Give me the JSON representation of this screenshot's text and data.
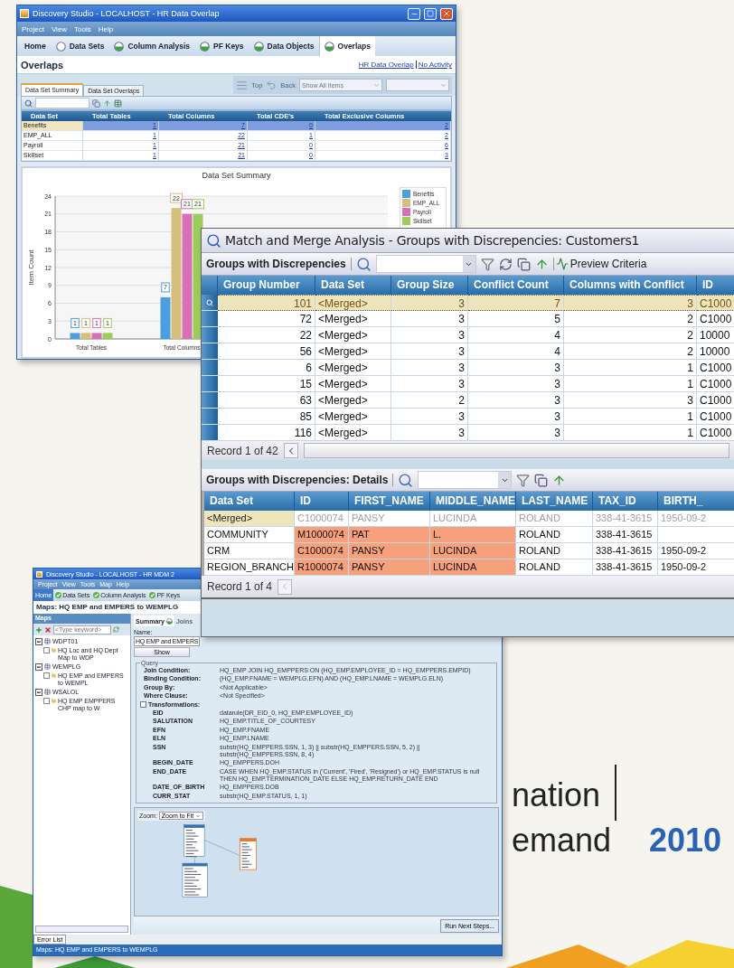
{
  "slide": {
    "line_1": "nation",
    "line_2": "emand",
    "year": "2010"
  },
  "overlap_window": {
    "title": "Discovery Studio - LOCALHOST - HR Data Overlap",
    "menu": [
      "Project",
      "View",
      "Tools",
      "Help"
    ],
    "nav_tabs": [
      {
        "label": "Home",
        "kind": "plain",
        "selected": false
      },
      {
        "label": "Data Sets",
        "kind": "empty-circle",
        "selected": false
      },
      {
        "label": "Column Analysis",
        "kind": "half-circle",
        "selected": false
      },
      {
        "label": "PF Keys",
        "kind": "half-circle",
        "selected": false
      },
      {
        "label": "Data Objects",
        "kind": "half-circle",
        "selected": false
      },
      {
        "label": "Overlaps",
        "kind": "half-circle",
        "selected": true
      }
    ],
    "heading": "Overlaps",
    "links": [
      "HR Data Overlap",
      "No Activity"
    ],
    "toolbar": {
      "top": "Top",
      "back": "Back",
      "filter": "Show All Items"
    },
    "sub_tabs": [
      {
        "label": "Data Set Summary",
        "selected": true
      },
      {
        "label": "Data Set Overlaps",
        "selected": false
      }
    ],
    "table": {
      "columns": [
        "Data Set",
        "Total Tables",
        "Total Columns",
        "Total CDE's",
        "Total Exclusive Columns"
      ],
      "rows": [
        {
          "cells": [
            "Benefits",
            "1",
            "7",
            "0",
            "2"
          ],
          "selected": true
        },
        {
          "cells": [
            "EMP_ALL",
            "1",
            "22",
            "1",
            "2"
          ],
          "selected": false
        },
        {
          "cells": [
            "Payroll",
            "1",
            "21",
            "0",
            "6"
          ],
          "selected": false
        },
        {
          "cells": [
            "Skillset",
            "1",
            "21",
            "0",
            "3"
          ],
          "selected": false
        }
      ]
    },
    "chart": {
      "chart_data": {
        "type": "bar",
        "title": "Data Set Summary",
        "ylabel": "Item Count",
        "categories": [
          "Total Tables",
          "Total Columns"
        ],
        "series": [
          {
            "name": "Benefits",
            "color": "#4a9fe0",
            "values": [
              1,
              7
            ]
          },
          {
            "name": "EMP_ALL",
            "color": "#d4c07a",
            "values": [
              1,
              22
            ]
          },
          {
            "name": "Payroll",
            "color": "#d870b8",
            "values": [
              1,
              21
            ]
          },
          {
            "name": "Skillset",
            "color": "#9ccc5a",
            "values": [
              1,
              21
            ]
          }
        ],
        "ylim": [
          0,
          24
        ],
        "yticks": [
          0,
          3,
          6,
          9,
          12,
          15,
          18,
          21,
          24
        ],
        "grid": true,
        "data_labels": true
      }
    }
  },
  "groups_window": {
    "title": "Match and Merge Analysis - Groups with Discrepencies: Customers1",
    "groups": {
      "title": "Groups with Discrepencies",
      "preview": "Preview Criteria",
      "columns": [
        "Group Number",
        "Data Set",
        "Group Size",
        "Conflict Count",
        "Columns with Conflict",
        "ID"
      ],
      "rows": [
        {
          "cells": [
            "101",
            "<Merged>",
            "3",
            "7",
            "3",
            "C1000"
          ],
          "selected": true
        },
        {
          "cells": [
            "72",
            "<Merged>",
            "3",
            "5",
            "2",
            "C1000"
          ],
          "selected": false
        },
        {
          "cells": [
            "22",
            "<Merged>",
            "3",
            "4",
            "2",
            "10000"
          ],
          "selected": false
        },
        {
          "cells": [
            "56",
            "<Merged>",
            "3",
            "4",
            "2",
            "10000"
          ],
          "selected": false
        },
        {
          "cells": [
            "6",
            "<Merged>",
            "3",
            "3",
            "1",
            "C1000"
          ],
          "selected": false
        },
        {
          "cells": [
            "15",
            "<Merged>",
            "3",
            "3",
            "1",
            "C1000"
          ],
          "selected": false
        },
        {
          "cells": [
            "63",
            "<Merged>",
            "2",
            "3",
            "3",
            "C1000"
          ],
          "selected": false
        },
        {
          "cells": [
            "85",
            "<Merged>",
            "3",
            "3",
            "1",
            "C1000"
          ],
          "selected": false
        },
        {
          "cells": [
            "116",
            "<Merged>",
            "3",
            "3",
            "1",
            "C1000"
          ],
          "selected": false
        }
      ],
      "record": "Record 1 of 42"
    },
    "details": {
      "title": "Groups with Discrepencies: Details",
      "columns": [
        "Data Set",
        "ID",
        "FIRST_NAME",
        "MIDDLE_NAME",
        "LAST_NAME",
        "TAX_ID",
        "BIRTH_"
      ],
      "rows": [
        {
          "kind": "merged",
          "cells": [
            {
              "text": "<Merged>",
              "conflict": false
            },
            {
              "text": "C1000074",
              "conflict": false
            },
            {
              "text": "PANSY",
              "conflict": false
            },
            {
              "text": "LUCINDA",
              "conflict": false
            },
            {
              "text": "ROLAND",
              "conflict": false
            },
            {
              "text": "338-41-3615",
              "conflict": false
            },
            {
              "text": "1950-09-2",
              "conflict": false
            }
          ]
        },
        {
          "kind": "source",
          "cells": [
            {
              "text": "COMMUNITY",
              "conflict": false
            },
            {
              "text": "M1000074",
              "conflict": true
            },
            {
              "text": "PAT",
              "conflict": true
            },
            {
              "text": "L.",
              "conflict": true
            },
            {
              "text": "ROLAND",
              "conflict": false
            },
            {
              "text": "338-41-3615",
              "conflict": false
            }
          ]
        },
        {
          "kind": "source",
          "cells": [
            {
              "text": "CRM",
              "conflict": false
            },
            {
              "text": "C1000074",
              "conflict": true
            },
            {
              "text": "PANSY",
              "conflict": true
            },
            {
              "text": "LUCINDA",
              "conflict": true
            },
            {
              "text": "ROLAND",
              "conflict": false
            },
            {
              "text": "338-41-3615",
              "conflict": false
            },
            {
              "text": "1950-09-2",
              "conflict": false
            }
          ]
        },
        {
          "kind": "source",
          "cells": [
            {
              "text": "REGION_BRANCH",
              "conflict": false
            },
            {
              "text": "R1000074",
              "conflict": true
            },
            {
              "text": "PANSY",
              "conflict": true
            },
            {
              "text": "LUCINDA",
              "conflict": true
            },
            {
              "text": "ROLAND",
              "conflict": false
            },
            {
              "text": "338-41-3615",
              "conflict": false
            },
            {
              "text": "1950-09-2",
              "conflict": false
            }
          ]
        }
      ],
      "record": "Record 1 of 4"
    }
  },
  "maps_window": {
    "title": "Discovery Studio - LOCALHOST - HR MDM 2",
    "menu": [
      "Project",
      "View",
      "Tools",
      "Map",
      "Help"
    ],
    "tabs": [
      {
        "label": "Home",
        "kind": "plain",
        "selected": true
      },
      {
        "label": "Data Sets",
        "kind": "check",
        "selected": false
      },
      {
        "label": "Column Analysis",
        "kind": "check",
        "selected": false
      },
      {
        "label": "PF Keys",
        "kind": "check",
        "selected": false
      }
    ],
    "heading": "Maps: HQ EMP and EMPERS to WEMPLG",
    "maps_panel": {
      "title": "Maps",
      "placeholder": "<Type keyword>",
      "tree": [
        {
          "label": "WDPT01",
          "expanded": true,
          "children": [
            {
              "label": "HQ Loc and HQ Dept Map to WDP",
              "checked": false
            }
          ]
        },
        {
          "label": "WEMPLG",
          "expanded": true,
          "children": [
            {
              "label": "HQ EMP and EMPERS to WEMPL",
              "checked": false
            }
          ]
        },
        {
          "label": "WSALOL",
          "expanded": true,
          "children": [
            {
              "label": "HQ EMP EMPPERS CHP map to W",
              "checked": false
            }
          ]
        }
      ]
    },
    "detail_tabs": [
      {
        "label": "Summary",
        "selected": true
      },
      {
        "label": "Joins",
        "selected": false
      }
    ],
    "name_label": "Name:",
    "name_value": "HQ EMP and EMPERS",
    "show_button": "Show",
    "query": {
      "title": "Query",
      "rows": [
        {
          "kind": "condition",
          "label": "Join Condition:",
          "value": "HQ_EMP JOIN HQ_EMPPERS ON (HQ_EMP.EMPLOYEE_ID = HQ_EMPPERS.EMPID)"
        },
        {
          "kind": "condition",
          "label": "Binding Condition:",
          "value": "(HQ_EMP.FNAME = WEMPLG.EFN) AND (HQ_EMP.LNAME = WEMPLG.ELN)"
        },
        {
          "kind": "condition",
          "label": "Group By:",
          "value": "<Not Applicable>"
        },
        {
          "kind": "condition",
          "label": "Where Clause:",
          "value": "<Not Specified>"
        },
        {
          "kind": "group",
          "label": "Transformations:"
        },
        {
          "kind": "transform",
          "label": "EID",
          "value": "datarule(DR_EID_0, HQ_EMP.EMPLOYEE_ID)"
        },
        {
          "kind": "transform",
          "label": "SALUTATION",
          "value": "HQ_EMP.TITLE_OF_COURTESY"
        },
        {
          "kind": "transform",
          "label": "EFN",
          "value": "HQ_EMP.FNAME"
        },
        {
          "kind": "transform",
          "label": "ELN",
          "value": "HQ_EMP.LNAME"
        },
        {
          "kind": "transform",
          "label": "SSN",
          "value": "substr(HQ_EMPPERS.SSN, 1, 3) || substr(HQ_EMPPERS.SSN, 5, 2) || substr(HQ_EMPPERS.SSN, 8, 4)"
        },
        {
          "kind": "transform",
          "label": "BEGIN_DATE",
          "value": "HQ_EMPPERS.DOH"
        },
        {
          "kind": "transform",
          "label": "END_DATE",
          "value": "CASE WHEN HQ_EMP.STATUS in ('Current', 'Fired', 'Resigned') or HQ_EMP.STATUS is null THEN HQ_EMP.TERMINATION_DATE ELSE HQ_EMP.RETURN_DATE END"
        },
        {
          "kind": "transform",
          "label": "DATE_OF_BIRTH",
          "value": "HQ_EMPPERS.DOB"
        },
        {
          "kind": "transform",
          "label": "CURR_STAT",
          "value": "substr(HQ_EMP.STATUS, 1, 1)"
        }
      ]
    },
    "zoom_label": "Zoom:",
    "zoom_value": "Zoom to Fit",
    "run_button": "Run Next Steps...",
    "error_tab": "Error List",
    "status": "Maps: HQ EMP and EMPERS to WEMPLG"
  }
}
